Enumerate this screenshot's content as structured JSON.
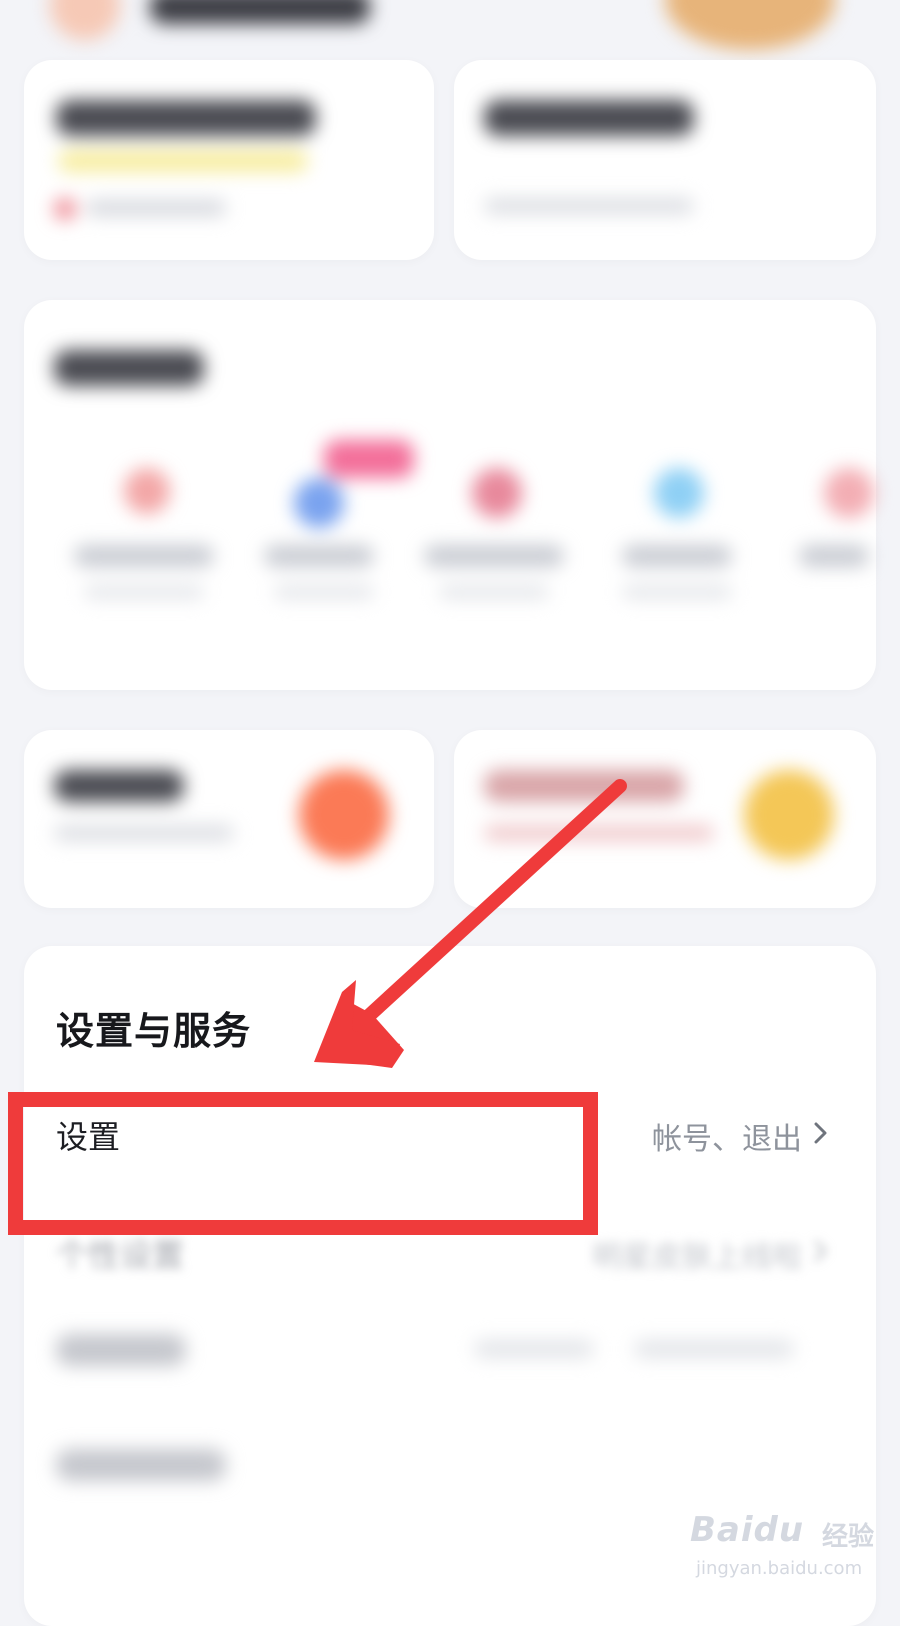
{
  "settings_section": {
    "title": "设置与服务",
    "rows": [
      {
        "label": "设置",
        "value": "帐号、退出"
      },
      {
        "label": "个性设置",
        "value": "明星皮肤上线啦"
      }
    ]
  },
  "annotation": {
    "color": "#ef3b3b"
  },
  "watermark": {
    "brand": "Baidu",
    "cn": "经验",
    "url": "jingyan.baidu.com"
  }
}
